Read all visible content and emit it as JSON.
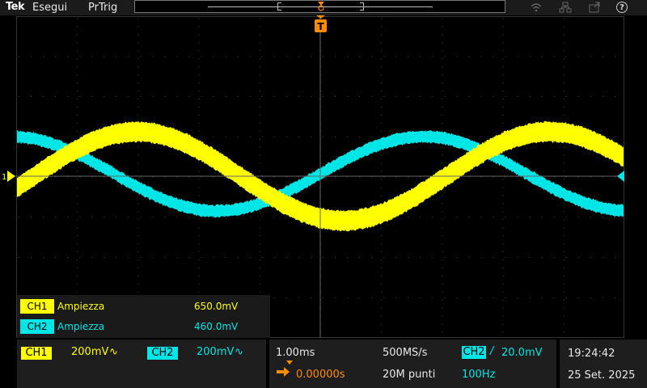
{
  "menubar": {
    "brand": "Tek",
    "menu_run": "Esegui",
    "menu_trigger": "PrTrig",
    "help": "?"
  },
  "channel_markers": {
    "ch1_label": "1",
    "trigger_label": "T"
  },
  "measurements": [
    {
      "channel": "CH1",
      "name": "Ampiezza",
      "value": "650.0mV",
      "color": "#ffff00"
    },
    {
      "channel": "CH2",
      "name": "Ampiezza",
      "value": "460.0mV",
      "color": "#00e5e5"
    }
  ],
  "bottom": {
    "ch1": {
      "label": "CH1",
      "scale": "200mV",
      "coupling": "∿"
    },
    "ch2": {
      "label": "CH2",
      "scale": "200mV",
      "coupling": "∿"
    },
    "horizontal": {
      "timebase": "1.00ms",
      "position": "0.00000s",
      "sample_rate": "500MS/s",
      "record_length": "20M punti"
    },
    "trigger": {
      "source": "CH2",
      "slope": "/",
      "level": "20.0mV",
      "frequency": "100Hz"
    },
    "clock": {
      "time": "19:24:42",
      "date": "25 Set. 2025"
    }
  },
  "colors": {
    "ch1": "#ffff00",
    "ch2": "#00e5e5",
    "trigger": "#ff8c00"
  },
  "icons": [
    "wifi-icon",
    "network-icon",
    "export-icon",
    "help-icon",
    "trigger-position-icon",
    "horizontal-position-arrow-icon",
    "rising-slope-icon",
    "ac-coupling-icon"
  ]
}
